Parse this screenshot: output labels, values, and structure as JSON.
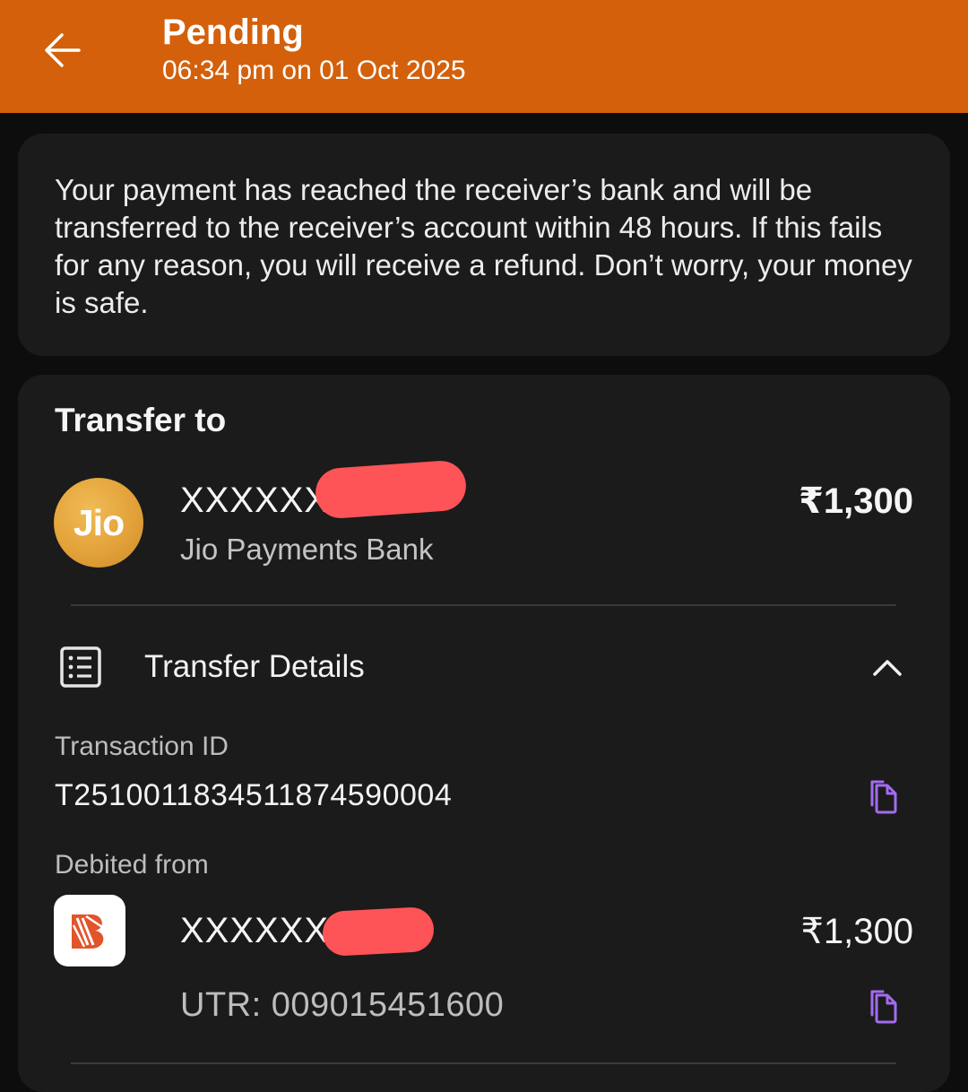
{
  "header": {
    "title": "Pending",
    "subtitle": "06:34 pm on 01 Oct 2025",
    "back_icon": "arrow-left-icon",
    "background": "#d4600b"
  },
  "notice": {
    "text": "Your payment has reached the receiver’s bank and will be transferred to the receiver’s account within 48 hours. If this fails for any reason, you will receive a refund. Don’t worry, your money is safe."
  },
  "transfer_to": {
    "section_title": "Transfer to",
    "logo_text": "Jio",
    "name": "XXXXXX",
    "bank": "Jio Payments Bank",
    "amount": "₹1,300"
  },
  "transfer_details": {
    "label": "Transfer Details",
    "icon": "receipt-list-icon",
    "chevron": "chevron-up-icon",
    "expanded": true,
    "transaction_id_label": "Transaction ID",
    "transaction_id": "T2510011834511874590004",
    "debited_from_label": "Debited from",
    "debited_name": "XXXXXX",
    "debited_amount": "₹1,300",
    "utr": "UTR: 009015451600",
    "copy_icon": "copy-icon",
    "accent": "#a36cf0",
    "redaction_color": "#ff5457"
  }
}
